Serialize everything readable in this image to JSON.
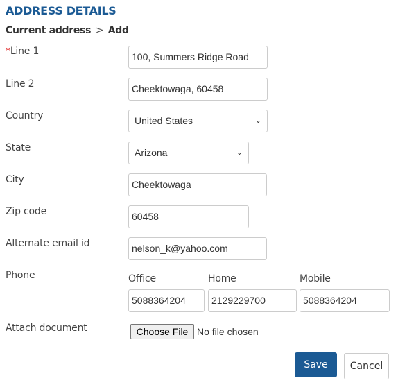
{
  "title": "ADDRESS DETAILS",
  "breadcrumb": {
    "parent": "Current address",
    "separator": ">",
    "current": "Add"
  },
  "fields": {
    "line1": {
      "label": "Line 1",
      "required_mark": "*",
      "value": "100, Summers Ridge Road"
    },
    "line2": {
      "label": "Line 2",
      "value": "Cheektowaga, 60458"
    },
    "country": {
      "label": "Country",
      "value": "United States"
    },
    "state": {
      "label": "State",
      "value": "Arizona"
    },
    "city": {
      "label": "City",
      "value": "Cheektowaga"
    },
    "zip": {
      "label": "Zip code",
      "value": "60458"
    },
    "email": {
      "label": "Alternate email id",
      "value": "nelson_k@yahoo.com"
    },
    "phone": {
      "label": "Phone",
      "office": {
        "label": "Office",
        "value": "5088364204"
      },
      "home": {
        "label": "Home",
        "value": "2129229700"
      },
      "mobile": {
        "label": "Mobile",
        "value": "5088364204"
      }
    },
    "attach": {
      "label": "Attach document",
      "button": "Choose File",
      "status": "No file chosen"
    }
  },
  "actions": {
    "save": "Save",
    "cancel": "Cancel"
  },
  "icons": {
    "chevron": "⌄"
  }
}
